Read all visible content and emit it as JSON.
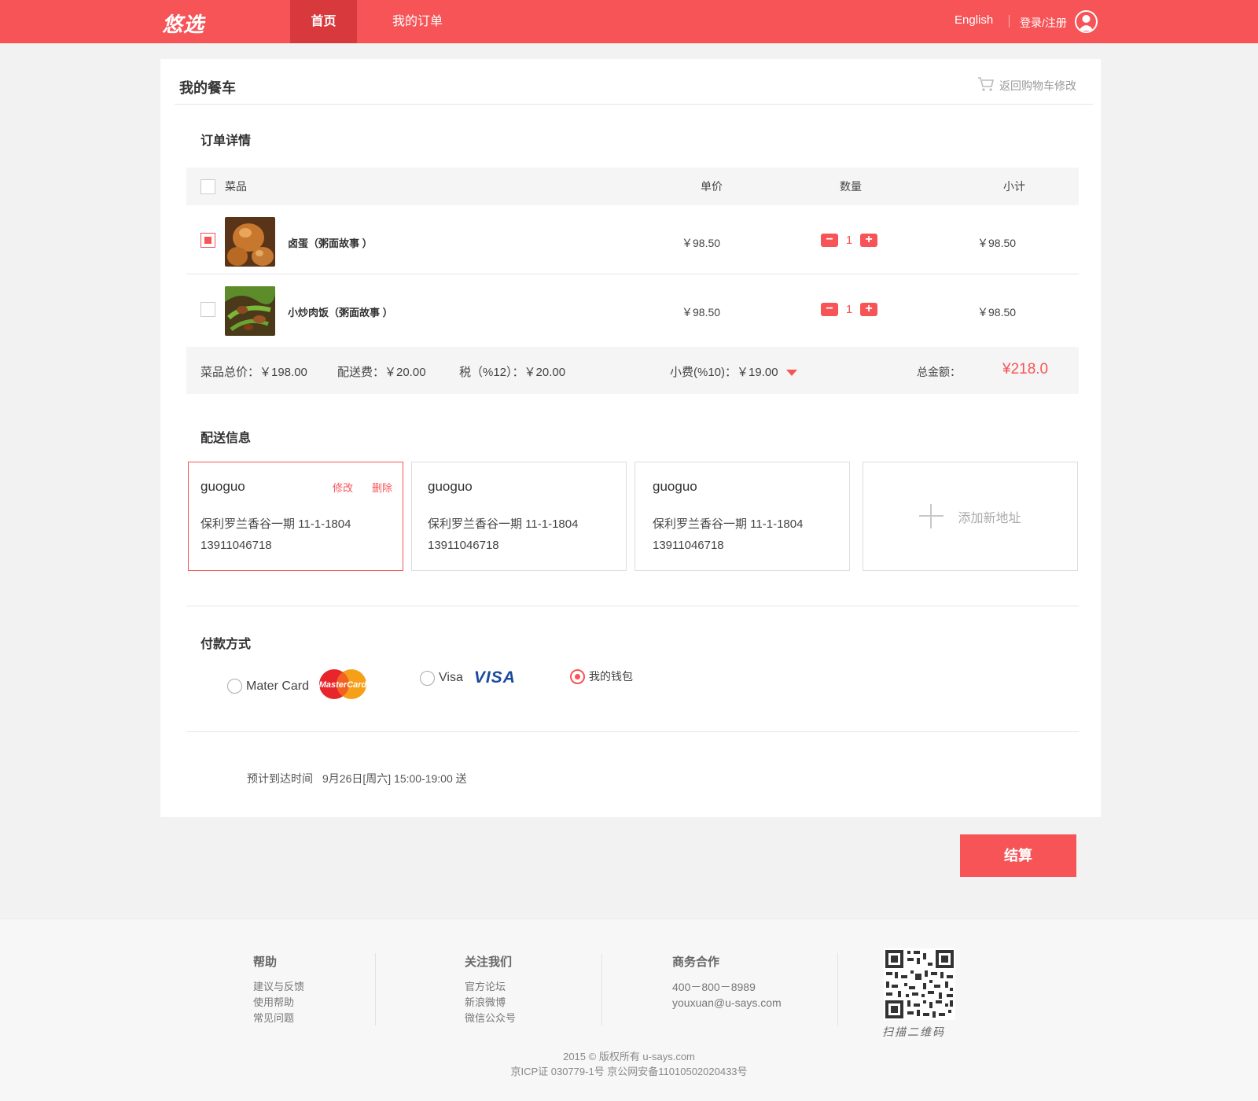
{
  "header": {
    "logo": "悠选",
    "nav": [
      {
        "label": "首页"
      },
      {
        "label": "我的订单"
      }
    ],
    "language": "English",
    "login": "登录/注册",
    "brand_color": "#f65457"
  },
  "cart": {
    "title": "我的餐车",
    "back_link": "返回购物车修改",
    "order_section": "订单详情",
    "columns": {
      "dish": "菜品",
      "unit_price": "单价",
      "quantity": "数量",
      "subtotal": "小计"
    },
    "items": [
      {
        "name": "卤蛋（粥面故事 ）",
        "price": "￥98.50",
        "qty": "1",
        "subtotal": "￥98.50",
        "checked": true
      },
      {
        "name": "小炒肉饭（粥面故事 ）",
        "price": "￥98.50",
        "qty": "1",
        "subtotal": "￥98.50",
        "checked": false
      }
    ],
    "summary": {
      "dishes_total": "菜品总价：￥198.00",
      "delivery_fee": "配送费：￥20.00",
      "tax": "税（%12）：￥20.00",
      "tip": "小费(%10)：￥19.00",
      "total_label": "总金额：",
      "total_value": "¥218.0"
    }
  },
  "delivery": {
    "title": "配送信息",
    "edit_label": "修改",
    "delete_label": "删除",
    "addresses": [
      {
        "name": "guoguo",
        "address": "保利罗兰香谷一期 11-1-1804",
        "phone": "13911046718"
      },
      {
        "name": "guoguo",
        "address": "保利罗兰香谷一期 11-1-1804",
        "phone": "13911046718"
      },
      {
        "name": "guoguo",
        "address": "保利罗兰香谷一期 11-1-1804",
        "phone": "13911046718"
      }
    ],
    "add_new": "添加新地址"
  },
  "payment": {
    "title": "付款方式",
    "options": [
      {
        "label": "Mater Card",
        "logo_text": "MasterCard",
        "selected": false
      },
      {
        "label": "Visa",
        "logo_text": "VISA",
        "selected": false
      },
      {
        "label": "我的钱包",
        "selected": true
      }
    ]
  },
  "eta": {
    "label": "预计到达时间",
    "value": "9月26日[周六] 15:00-19:00 送"
  },
  "checkout": "结算",
  "footer": {
    "help": {
      "title": "帮助",
      "items": [
        "建议与反馈",
        "使用帮助",
        "常见问题"
      ]
    },
    "follow": {
      "title": "关注我们",
      "items": [
        "官方论坛",
        "新浪微博",
        "微信公众号"
      ]
    },
    "business": {
      "title": "商务合作",
      "items": [
        "400－800－8989",
        "youxuan@u-says.com"
      ]
    },
    "qr_caption": "扫描二维码",
    "copyright": "2015 © 版权所有 u-says.com",
    "icp": "京ICP证 030779-1号 京公网安备11010502020433号"
  }
}
